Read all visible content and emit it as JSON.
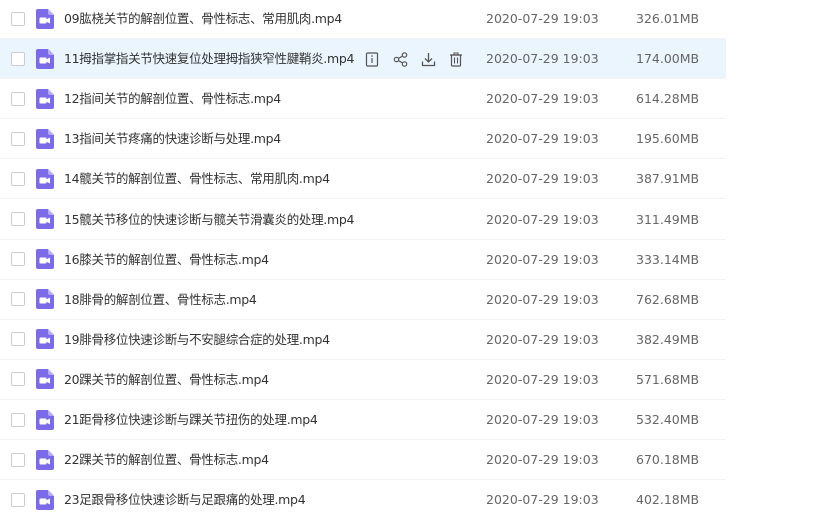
{
  "colors": {
    "accent": "#7b6be8",
    "hover_row": "#eaf5fd",
    "text_primary": "#333333",
    "text_secondary": "#666666"
  },
  "hover_actions": [
    "details-icon",
    "share-icon",
    "download-icon",
    "delete-icon"
  ],
  "files": [
    {
      "name": "09肱桡关节的解剖位置、骨性标志、常用肌肉.mp4",
      "date": "2020-07-29 19:03",
      "size": "326.01MB",
      "icon": "video-file-icon"
    },
    {
      "name": "11拇指掌指关节快速复位处理拇指狭窄性腱鞘炎.mp4",
      "date": "2020-07-29 19:03",
      "size": "174.00MB",
      "icon": "video-file-icon",
      "hovered": true
    },
    {
      "name": "12指间关节的解剖位置、骨性标志.mp4",
      "date": "2020-07-29 19:03",
      "size": "614.28MB",
      "icon": "video-file-icon"
    },
    {
      "name": "13指间关节疼痛的快速诊断与处理.mp4",
      "date": "2020-07-29 19:03",
      "size": "195.60MB",
      "icon": "video-file-icon"
    },
    {
      "name": "14髋关节的解剖位置、骨性标志、常用肌肉.mp4",
      "date": "2020-07-29 19:03",
      "size": "387.91MB",
      "icon": "video-file-icon"
    },
    {
      "name": "15髋关节移位的快速诊断与髋关节滑囊炎的处理.mp4",
      "date": "2020-07-29 19:03",
      "size": "311.49MB",
      "icon": "video-file-icon"
    },
    {
      "name": "16膝关节的解剖位置、骨性标志.mp4",
      "date": "2020-07-29 19:03",
      "size": "333.14MB",
      "icon": "video-file-icon"
    },
    {
      "name": "18腓骨的解剖位置、骨性标志.mp4",
      "date": "2020-07-29 19:03",
      "size": "762.68MB",
      "icon": "video-file-icon"
    },
    {
      "name": "19腓骨移位快速诊断与不安腿综合症的处理.mp4",
      "date": "2020-07-29 19:03",
      "size": "382.49MB",
      "icon": "video-file-icon"
    },
    {
      "name": "20踝关节的解剖位置、骨性标志.mp4",
      "date": "2020-07-29 19:03",
      "size": "571.68MB",
      "icon": "video-file-icon"
    },
    {
      "name": "21距骨移位快速诊断与踝关节扭伤的处理.mp4",
      "date": "2020-07-29 19:03",
      "size": "532.40MB",
      "icon": "video-file-icon"
    },
    {
      "name": "22踝关节的解剖位置、骨性标志.mp4",
      "date": "2020-07-29 19:03",
      "size": "670.18MB",
      "icon": "video-file-icon"
    },
    {
      "name": "23足跟骨移位快速诊断与足跟痛的处理.mp4",
      "date": "2020-07-29 19:03",
      "size": "402.18MB",
      "icon": "video-file-icon"
    }
  ]
}
